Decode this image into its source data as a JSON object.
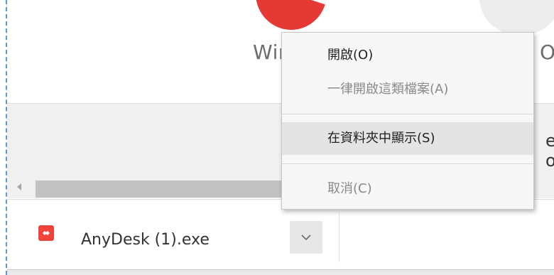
{
  "background_page": {
    "left_label": "Win",
    "right_label": "OS",
    "band_text": "e o"
  },
  "context_menu": {
    "items": [
      {
        "label": "開啟(O)",
        "enabled": true,
        "highlighted": false
      },
      {
        "label": "一律開啟這類檔案(A)",
        "enabled": false,
        "highlighted": false
      },
      {
        "label": "在資料夾中顯示(S)",
        "enabled": true,
        "highlighted": true
      },
      {
        "label": "取消(C)",
        "enabled": false,
        "highlighted": false
      }
    ]
  },
  "download_shelf": {
    "file_name": "AnyDesk (1).exe",
    "file_icon": "anydesk-icon",
    "menu_button_icon": "chevron-down-icon"
  },
  "colors": {
    "anydesk_red": "#ef443b",
    "menu_background": "#f7f7f7",
    "menu_highlight": "#e4e4e4",
    "disabled_text": "#8a8a8a"
  }
}
